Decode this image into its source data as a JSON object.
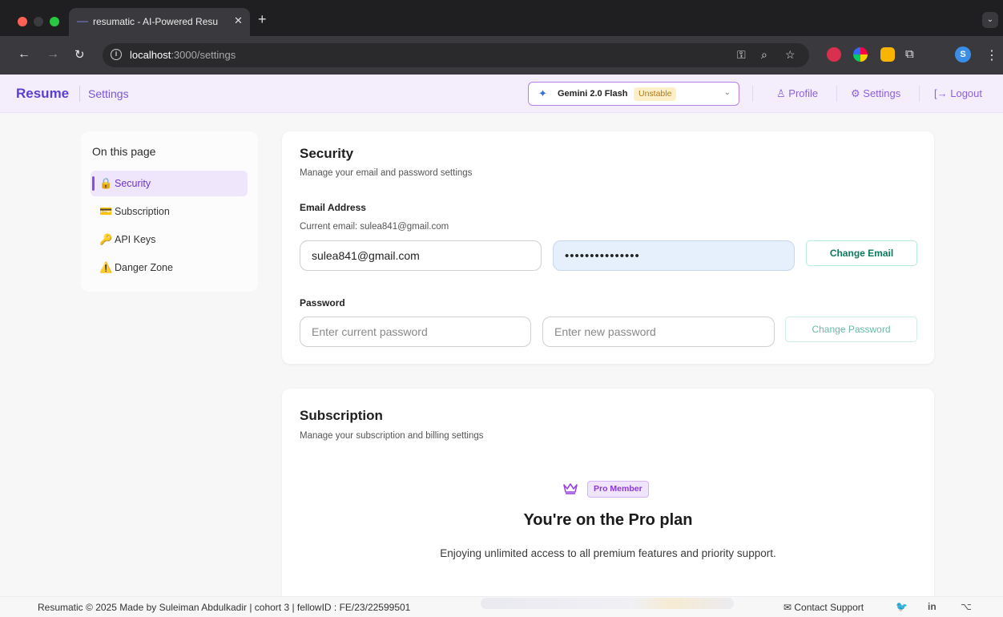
{
  "browser": {
    "tab_title": "resumatic - AI-Powered Resu",
    "tab_close": "✕",
    "new_tab": "+",
    "tab_menu": "⌄",
    "url_host": "localhost",
    "url_path": ":3000/settings",
    "profile_initial": "S"
  },
  "header": {
    "brand": "Resume",
    "breadcrumb": "Settings",
    "model_name": "Gemini 2.0 Flash",
    "model_badge": "Unstable",
    "profile": "Profile",
    "settings": "Settings",
    "logout": "Logout"
  },
  "toc": {
    "title": "On this page",
    "items": [
      {
        "label": "Security",
        "icon": "🔒"
      },
      {
        "label": "Subscription",
        "icon": "💳"
      },
      {
        "label": "API Keys",
        "icon": "🔑"
      },
      {
        "label": "Danger Zone",
        "icon": "⚠️"
      }
    ]
  },
  "security": {
    "title": "Security",
    "description": "Manage your email and password settings",
    "email_label": "Email Address",
    "current_email": "Current email: sulea841@gmail.com",
    "email_value": "sulea841@gmail.com",
    "password_value": "•••••••••••••••",
    "change_email": "Change Email",
    "password_label": "Password",
    "current_password_placeholder": "Enter current password",
    "new_password_placeholder": "Enter new password",
    "change_password": "Change Password"
  },
  "subscription": {
    "title": "Subscription",
    "description": "Manage your subscription and billing settings",
    "badge": "Pro Member",
    "plan_title": "You're on the Pro plan",
    "plan_desc": "Enjoying unlimited access to all premium features and priority support."
  },
  "footer": {
    "text": "Resumatic © 2025   Made by Suleiman Abdulkadir | cohort 3 | fellowID : FE/23/22599501",
    "contact": "Contact Support"
  },
  "colors": {
    "brand": "#5b3fd3",
    "accent": "#8b5fe3",
    "success": "#0e7a5c"
  }
}
